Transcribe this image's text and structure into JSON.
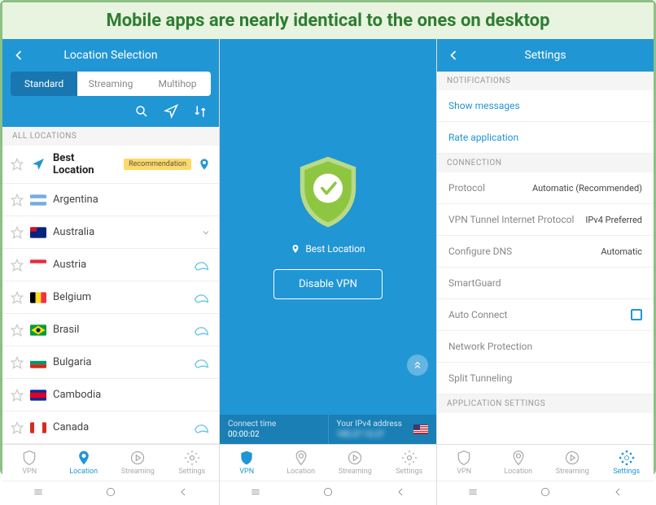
{
  "caption": "Mobile apps are nearly identical to the ones on desktop",
  "screen1": {
    "header_title": "Location Selection",
    "tabs": {
      "standard": "Standard",
      "streaming": "Streaming",
      "multihop": "Multihop"
    },
    "section": "ALL LOCATIONS",
    "best": "Best Location",
    "recommendation": "Recommendation",
    "items": [
      {
        "name": "Argentina"
      },
      {
        "name": "Australia"
      },
      {
        "name": "Austria"
      },
      {
        "name": "Belgium"
      },
      {
        "name": "Brasil"
      },
      {
        "name": "Bulgaria"
      },
      {
        "name": "Cambodia"
      },
      {
        "name": "Canada"
      }
    ],
    "nav": {
      "vpn": "VPN",
      "location": "Location",
      "streaming": "Streaming",
      "settings": "Settings"
    }
  },
  "screen2": {
    "location": "Best Location",
    "button": "Disable VPN",
    "connect_label": "Connect time",
    "connect_time": "00:00:02",
    "ip_label": "Your IPv4 address",
    "ip_value": "185.27.13.27",
    "nav": {
      "vpn": "VPN",
      "location": "Location",
      "streaming": "Streaming",
      "settings": "Settings"
    }
  },
  "screen3": {
    "header_title": "Settings",
    "sec_notifications": "NOTIFICATIONS",
    "show_messages": "Show messages",
    "rate_app": "Rate application",
    "sec_connection": "CONNECTION",
    "protocol_label": "Protocol",
    "protocol_value": "Automatic (Recommended)",
    "tunnel_label": "VPN Tunnel Internet Protocol",
    "tunnel_value": "IPv4 Preferred",
    "dns_label": "Configure DNS",
    "dns_value": "Automatic",
    "smartguard": "SmartGuard",
    "autoconnect": "Auto Connect",
    "netprotect": "Network Protection",
    "split": "Split Tunneling",
    "sec_app": "APPLICATION SETTINGS",
    "nav": {
      "vpn": "VPN",
      "location": "Location",
      "streaming": "Streaming",
      "settings": "Settings"
    }
  }
}
